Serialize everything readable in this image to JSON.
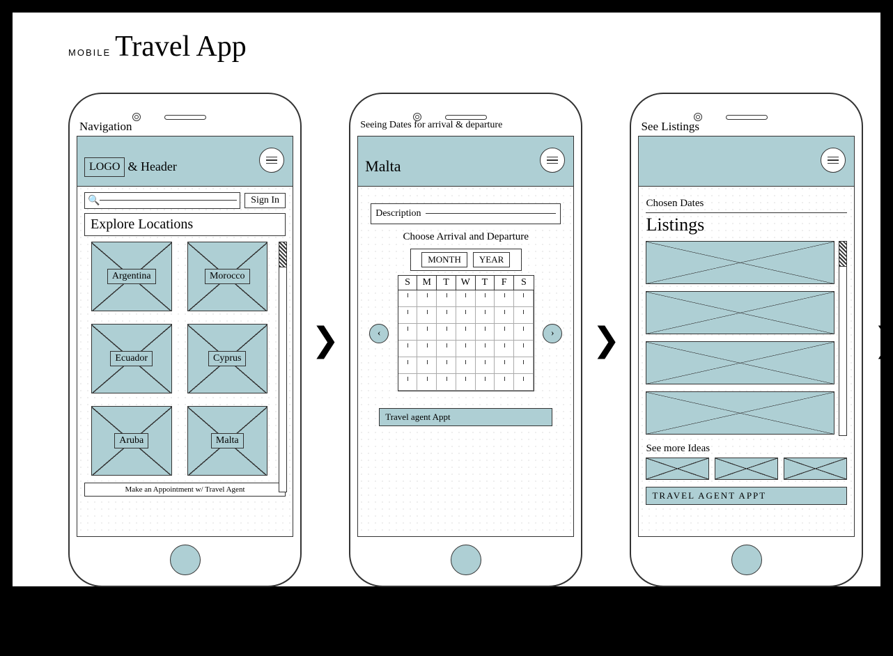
{
  "title": {
    "small": "MOBILE",
    "big": "Travel App"
  },
  "arrow_glyph": "❯",
  "screens": {
    "nav": {
      "label": "Navigation",
      "logo": "LOGO",
      "header_suffix": "& Header",
      "signin": "Sign In",
      "section": "Explore Locations",
      "tiles": [
        "Argentina",
        "Morocco",
        "Ecuador",
        "Cyprus",
        "Aruba",
        "Malta"
      ],
      "footer": "Make an Appointment w/ Travel Agent"
    },
    "dates": {
      "label": "Seeing Dates for arrival & departure",
      "header": "Malta",
      "desc_label": "Description",
      "subtitle": "Choose Arrival and Departure",
      "month": "MONTH",
      "year": "YEAR",
      "days": [
        "S",
        "M",
        "T",
        "W",
        "T",
        "F",
        "S"
      ],
      "agent": "Travel agent Appt"
    },
    "listings": {
      "label": "See Listings",
      "chosen": "Chosen Dates",
      "title": "Listings",
      "ideas_title": "See more Ideas",
      "agent": "TRAVEL AGENT APPT"
    }
  }
}
